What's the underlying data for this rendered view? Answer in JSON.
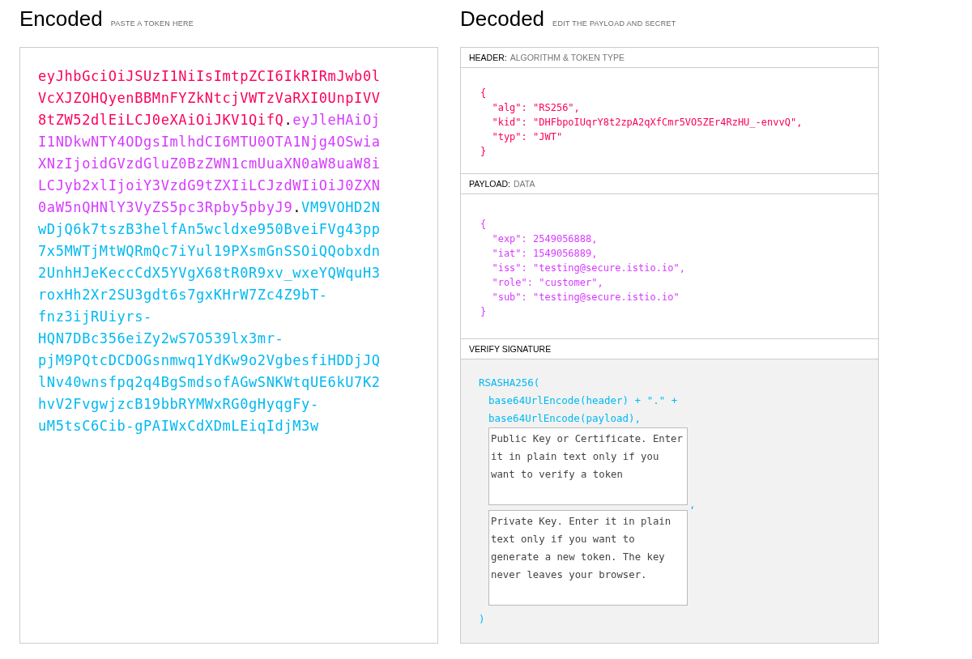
{
  "encoded": {
    "title": "Encoded",
    "hint": "PASTE A TOKEN HERE",
    "lines": [
      [
        {
          "kind": "header",
          "text": "eyJhbGciOiJSUzI1NiIsImtpZCI6IkRIRmJwb0l"
        }
      ],
      [
        {
          "kind": "header",
          "text": "VcXJZOHQyenBBMnFYZkNtcjVWTzVaRXI0UnpIVV"
        }
      ],
      [
        {
          "kind": "header",
          "text": "8tZW52dlEiLCJ0eXAiOiJKV1QifQ"
        },
        {
          "kind": "dot",
          "text": "."
        },
        {
          "kind": "payload",
          "text": "eyJleHAiOj"
        }
      ],
      [
        {
          "kind": "payload",
          "text": "I1NDkwNTY4ODgsImlhdCI6MTU0OTA1Njg4OSwia"
        }
      ],
      [
        {
          "kind": "payload",
          "text": "XNzIjoidGVzdGluZ0BzZWN1cmUuaXN0aW8uaW8i"
        }
      ],
      [
        {
          "kind": "payload",
          "text": "LCJyb2xlIjoiY3VzdG9tZXIiLCJzdWIiOiJ0ZXN"
        }
      ],
      [
        {
          "kind": "payload",
          "text": "0aW5nQHNlY3VyZS5pc3Rpby5pbyJ9"
        },
        {
          "kind": "dot",
          "text": "."
        },
        {
          "kind": "signature",
          "text": "VM9VOHD2N"
        }
      ],
      [
        {
          "kind": "signature",
          "text": "wDjQ6k7tszB3helfAn5wcldxe950BveiFVg43pp"
        }
      ],
      [
        {
          "kind": "signature",
          "text": "7x5MWTjMtWQRmQc7iYul19PXsmGnSSOiQQobxdn"
        }
      ],
      [
        {
          "kind": "signature",
          "text": "2UnhHJeKeccCdX5YVgX68tR0R9xv_wxeYQWquH3"
        }
      ],
      [
        {
          "kind": "signature",
          "text": "roxHh2Xr2SU3gdt6s7gxKHrW7Zc4Z9bT-"
        }
      ],
      [
        {
          "kind": "signature",
          "text": "fnz3ijRUiyrs-"
        }
      ],
      [
        {
          "kind": "signature",
          "text": "HQN7DBc356eiZy2wS7O539lx3mr-"
        }
      ],
      [
        {
          "kind": "signature",
          "text": "pjM9PQtcDCDOGsnmwq1YdKw9o2VgbesfiHDDjJQ"
        }
      ],
      [
        {
          "kind": "signature",
          "text": "lNv40wnsfpq2q4BgSmdsofAGwSNKWtqUE6kU7K2"
        }
      ],
      [
        {
          "kind": "signature",
          "text": "hvV2FvgwjzcB19bbRYMWxRG0gHyqgFy-"
        }
      ],
      [
        {
          "kind": "signature",
          "text": "uM5tsC6Cib-gPAIWxCdXDmLEiqIdjM3w"
        }
      ]
    ]
  },
  "decoded": {
    "title": "Decoded",
    "hint": "EDIT THE PAYLOAD AND SECRET",
    "sections": [
      {
        "kind": "header",
        "label": "HEADER:",
        "sublabel": "ALGORITHM & TOKEN TYPE",
        "lines": [
          "{",
          "  \"alg\": \"RS256\",",
          "  \"kid\": \"DHFbpoIUqrY8t2zpA2qXfCmr5VO5ZEr4RzHU_-envvQ\",",
          "  \"typ\": \"JWT\"",
          "}"
        ]
      },
      {
        "kind": "payload",
        "label": "PAYLOAD:",
        "sublabel": "DATA",
        "lines": [
          "{",
          "  \"exp\": 2549056888,",
          "  \"iat\": 1549056889,",
          "  \"iss\": \"testing@secure.istio.io\",",
          "  \"role\": \"customer\",",
          "  \"sub\": \"testing@secure.istio.io\"",
          "}"
        ]
      },
      {
        "kind": "verify",
        "label": "VERIFY SIGNATURE",
        "open": "RSASHA256(",
        "args": [
          "base64UrlEncode(header) + \".\" +",
          "base64UrlEncode(payload),"
        ],
        "public_key": {
          "placeholder": "Public Key or Certificate. Enter it in plain text only if you want to verify a token"
        },
        "comma": ",",
        "private_key": {
          "placeholder": "Private Key. Enter it in plain text only if you want to generate a new token. The key never leaves your browser."
        },
        "close": ")"
      }
    ]
  }
}
